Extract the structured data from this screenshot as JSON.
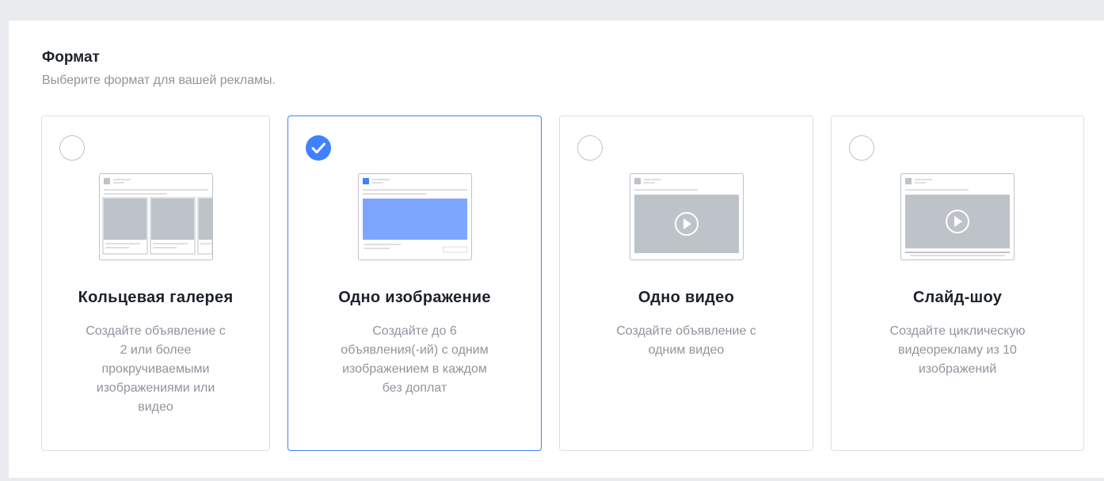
{
  "section": {
    "title": "Формат",
    "subtitle": "Выберите формат для вашей рекламы."
  },
  "formats": [
    {
      "title": "Кольцевая галерея",
      "description": "Создайте объявление с\n2 или более\nпрокручиваемыми\nизображениями или\nвидео",
      "selected": false,
      "icon": "carousel-preview-icon"
    },
    {
      "title": "Одно изображение",
      "description": "Создайте до 6\nобъявления(-ий) с одним\nизображением в каждом\nбез доплат",
      "selected": true,
      "icon": "single-image-preview-icon"
    },
    {
      "title": "Одно видео",
      "description": "Создайте объявление с\nодним видео",
      "selected": false,
      "icon": "single-video-preview-icon"
    },
    {
      "title": "Слайд-шоу",
      "description": "Создайте циклическую\nвидеорекламу из 10\nизображений",
      "selected": false,
      "icon": "slideshow-preview-icon"
    }
  ],
  "colors": {
    "accent": "#4080ff",
    "border": "#dddfe2",
    "text_primary": "#1d2129",
    "text_secondary": "#90949c",
    "illustration_gray": "#bec3c9"
  }
}
